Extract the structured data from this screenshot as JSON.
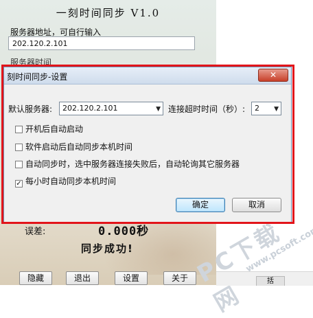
{
  "app": {
    "title": "一刻时间同步 V1.0",
    "server_label": "服务器地址，可自行输入",
    "server_value": "202.120.2.101",
    "hidden_label": "服务器时间",
    "error_label": "误差:",
    "error_value": "0.000秒",
    "status": "同步成功!",
    "buttons": [
      "隐藏",
      "退出",
      "设置",
      "关于"
    ]
  },
  "dialog": {
    "title": "刻时间同步-设置",
    "close_symbol": "✕",
    "server_label": "默认服务器:",
    "server_value": "202.120.2.101",
    "timeout_label": "连接超时时间（秒）:",
    "timeout_value": "2",
    "options": [
      {
        "label": "开机后自动启动",
        "checked": false
      },
      {
        "label": "软件启动后自动同步本机时间",
        "checked": false
      },
      {
        "label": "自动同步时，选中服务器连接失败后，自动轮询其它服务器",
        "checked": false
      },
      {
        "label": "每小时自动同步本机时间",
        "checked": true
      }
    ],
    "ok_label": "确定",
    "cancel_label": "取消"
  },
  "watermark": {
    "brand": "PC下载网",
    "url": "www.pcsoft.com.cn"
  },
  "taskbar": {
    "tab_label": "括"
  },
  "colors": {
    "highlight": "#e2141a",
    "titlebar": "#cfdcec"
  }
}
